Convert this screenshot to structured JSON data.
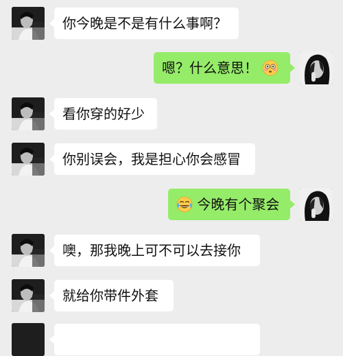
{
  "conversation": {
    "messages": [
      {
        "sender": "contact",
        "text": "你今晚是不是有什么事啊？"
      },
      {
        "sender": "me",
        "text": "嗯？什么意思！",
        "trailing_emoji": "flushed-face-emoji"
      },
      {
        "sender": "contact",
        "text": "看你穿的好少"
      },
      {
        "sender": "contact",
        "text": "你别误会，我是担心你会感冒"
      },
      {
        "sender": "me",
        "text": "今晚有个聚会",
        "leading_emoji": "crying-laughing-emoji"
      },
      {
        "sender": "contact",
        "text": "噢，那我晚上可不可以去接你"
      },
      {
        "sender": "contact",
        "text": "就给你带件外套"
      }
    ]
  },
  "colors": {
    "background": "#ededed",
    "incoming_bubble": "#ffffff",
    "outgoing_bubble": "#95ec69",
    "text": "#111111"
  },
  "icons": {
    "contact_avatar": "male-avatar-photo",
    "my_avatar": "female-avatar-photo"
  }
}
